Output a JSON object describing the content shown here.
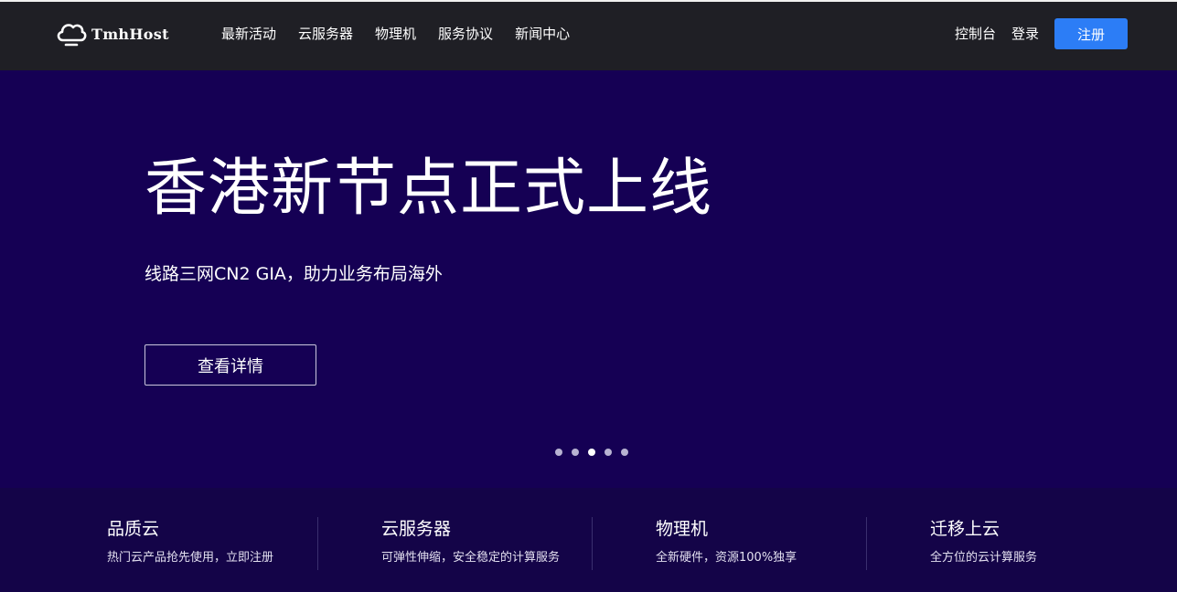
{
  "header": {
    "logo_text": "TmhHost",
    "nav": [
      {
        "label": "最新活动"
      },
      {
        "label": "云服务器"
      },
      {
        "label": "物理机"
      },
      {
        "label": "服务协议"
      },
      {
        "label": "新闻中心"
      }
    ],
    "console_label": "控制台",
    "login_label": "登录",
    "register_label": "注册"
  },
  "hero": {
    "title": "香港新节点正式上线",
    "subtitle": "线路三网CN2 GIA，助力业务布局海外",
    "button_label": "查看详情",
    "carousel": {
      "count": 5,
      "active_index": 2
    }
  },
  "features": [
    {
      "title": "品质云",
      "desc": "热门云产品抢先使用，立即注册"
    },
    {
      "title": "云服务器",
      "desc": "可弹性伸缩，安全稳定的计算服务"
    },
    {
      "title": "物理机",
      "desc": "全新硬件，资源100%独享"
    },
    {
      "title": "迁移上云",
      "desc": "全方位的云计算服务"
    }
  ],
  "colors": {
    "topbar_bg": "#1f1f25",
    "hero_bg": "#150054",
    "features_bg": "#140448",
    "accent": "#2c7df6"
  },
  "icons": {
    "logo": "cloud-icon"
  }
}
